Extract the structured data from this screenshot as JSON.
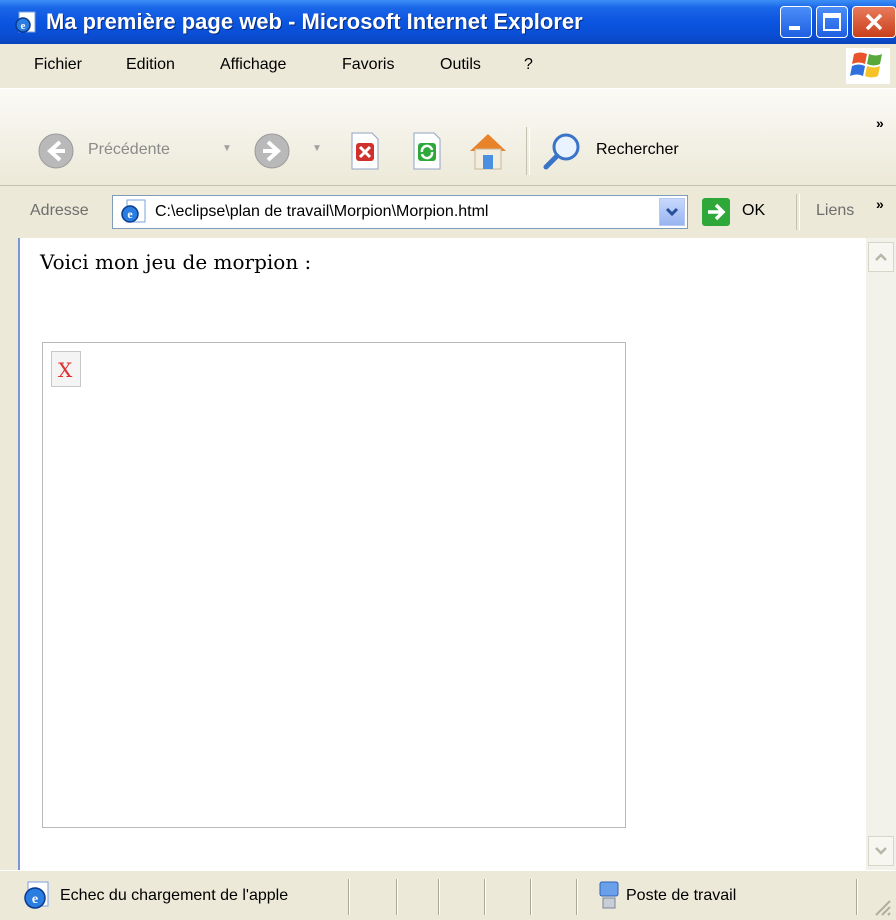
{
  "window": {
    "title": "Ma première page web - Microsoft Internet Explorer",
    "title_icon": "ie-page-icon"
  },
  "menu": {
    "items": [
      "Fichier",
      "Edition",
      "Affichage",
      "Favoris",
      "Outils",
      "?"
    ]
  },
  "toolbar": {
    "back_label": "Précédente",
    "search_label": "Rechercher",
    "overflow": "»"
  },
  "address": {
    "label": "Adresse",
    "value": "C:\\eclipse\\plan de travail\\Morpion\\Morpion.html",
    "go_label": "OK",
    "links_label": "Liens",
    "overflow": "»"
  },
  "page": {
    "text": "Voici mon jeu de morpion :",
    "broken_glyph": "X"
  },
  "status": {
    "message": "Echec du chargement de l'apple",
    "zone": "Poste de travail"
  },
  "colors": {
    "titlebar": "#0b55e0",
    "chrome": "#ece9d8",
    "go_green": "#2fa83a",
    "stop_red": "#d0312d"
  }
}
